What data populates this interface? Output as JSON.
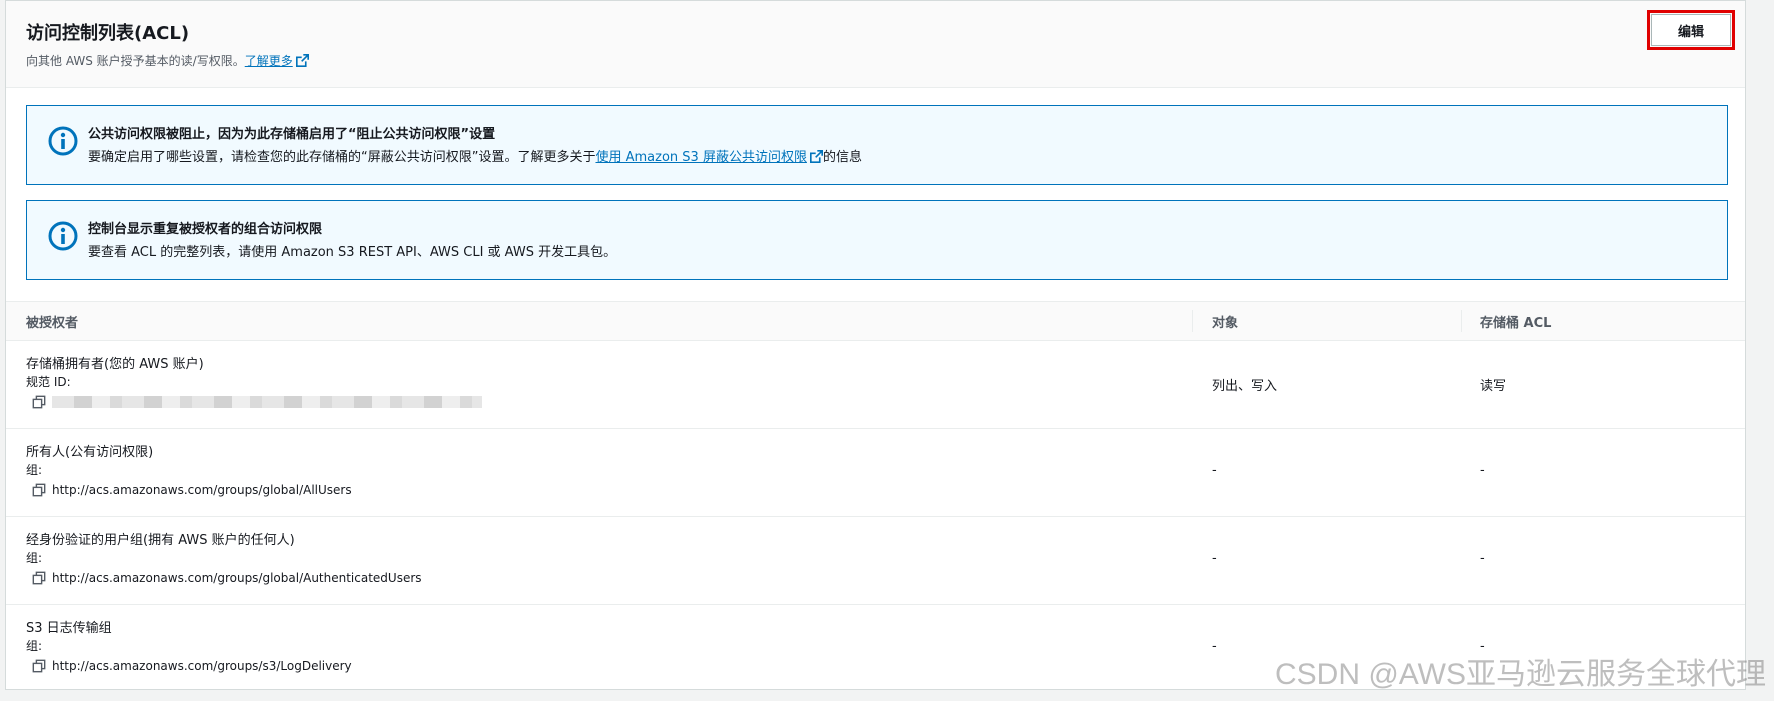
{
  "header": {
    "title": "访问控制列表(ACL)",
    "subtitle": "向其他 AWS 账户授予基本的读/写权限。",
    "learn_more": "了解更多",
    "edit_label": "编辑"
  },
  "banners": [
    {
      "title": "公共访问权限被阻止，因为为此存储桶启用了“阻止公共访问权限”设置",
      "text_before": "要确定启用了哪些设置，请检查您的此存储桶的“屏蔽公共访问权限”设置。了解更多关于",
      "link": "使用 Amazon S3 屏蔽公共访问权限",
      "text_after": "的信息"
    },
    {
      "title": "控制台显示重复被授权者的组合访问权限",
      "text": "要查看 ACL 的完整列表，请使用 Amazon S3 REST API、AWS CLI 或 AWS 开发工具包。"
    }
  ],
  "table": {
    "headers": [
      "被授权者",
      "对象",
      "存储桶 ACL"
    ],
    "rows": [
      {
        "name": "存储桶拥有者(您的 AWS 账户)",
        "type_label": "规范 ID:",
        "value": "",
        "object": "列出、写入",
        "bucket_acl": "读写"
      },
      {
        "name": "所有人(公有访问权限)",
        "type_label": "组:",
        "value": "http://acs.amazonaws.com/groups/global/AllUsers",
        "object": "-",
        "bucket_acl": "-"
      },
      {
        "name": "经身份验证的用户组(拥有 AWS 账户的任何人)",
        "type_label": "组:",
        "value": "http://acs.amazonaws.com/groups/global/AuthenticatedUsers",
        "object": "-",
        "bucket_acl": "-"
      },
      {
        "name": "S3 日志传输组",
        "type_label": "组:",
        "value": "http://acs.amazonaws.com/groups/s3/LogDelivery",
        "object": "-",
        "bucket_acl": "-"
      }
    ]
  },
  "watermark": "CSDN @AWS亚马逊云服务全球代理",
  "colors": {
    "link": "#0073bb",
    "banner_bg": "#f1faff",
    "banner_border": "#0073bb",
    "highlight": "#e00000"
  },
  "icons": {
    "info": "info-circle-icon",
    "external": "external-link-icon",
    "copy": "copy-icon"
  }
}
